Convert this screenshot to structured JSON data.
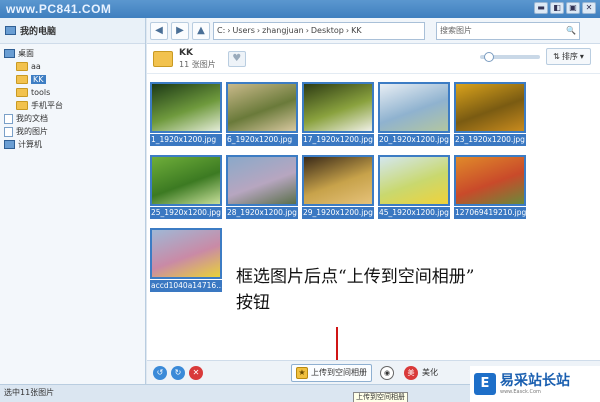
{
  "window": {
    "watermark": "www.PC841.COM",
    "buttons": [
      "▬",
      "◧",
      "▣",
      "✕"
    ]
  },
  "sidebar": {
    "title": "我的电脑",
    "items": [
      {
        "label": "桌面",
        "icon": "pc-icon"
      },
      {
        "label": "aa",
        "icon": "folder-icon"
      },
      {
        "label": "KK",
        "icon": "folder-icon",
        "selected": true
      },
      {
        "label": "tools",
        "icon": "folder-icon"
      },
      {
        "label": "手机平台",
        "icon": "folder-icon"
      },
      {
        "label": "我的文档",
        "icon": "doc-icon"
      },
      {
        "label": "我的图片",
        "icon": "doc-icon"
      },
      {
        "label": "计算机",
        "icon": "pc-icon"
      }
    ]
  },
  "toolbar": {
    "path": [
      "C:",
      "Users",
      "zhangjuan",
      "Desktop",
      "KK"
    ],
    "search_placeholder": "搜索图片"
  },
  "folder": {
    "name": "KK",
    "count": "11 张图片",
    "sort_label": "排序"
  },
  "thumbnails": [
    {
      "name": "1_1920x1200.jpg",
      "colors": [
        "#1d3a16",
        "#6f9a3d",
        "#e4ecd8"
      ]
    },
    {
      "name": "6_1920x1200.jpg",
      "colors": [
        "#c9b98a",
        "#6a7a3a",
        "#d8c8a0"
      ]
    },
    {
      "name": "17_1920x1200.jpg",
      "colors": [
        "#2e3c14",
        "#8aa23e",
        "#f1f1e8"
      ]
    },
    {
      "name": "20_1920x1200.jpg",
      "colors": [
        "#e8eef4",
        "#8fb2cf",
        "#b3c6a0"
      ]
    },
    {
      "name": "23_1920x1200.jpg",
      "colors": [
        "#d9a21c",
        "#7a5b12",
        "#c98b1e"
      ]
    },
    {
      "name": "25_1920x1200.jpg",
      "colors": [
        "#6fae3a",
        "#3c7a22",
        "#c7df9a"
      ]
    },
    {
      "name": "28_1920x1200.jpg",
      "colors": [
        "#8aa9c9",
        "#b7a6c0",
        "#5a6f4a"
      ]
    },
    {
      "name": "29_1920x1200.jpg",
      "colors": [
        "#3a2a18",
        "#c7a24a",
        "#e6c27a"
      ]
    },
    {
      "name": "45_1920x1200.jpg",
      "colors": [
        "#d4e7ef",
        "#c9d86e",
        "#f0d23a"
      ]
    },
    {
      "name": "127069419210.jpg",
      "colors": [
        "#e08a2a",
        "#c94a2a",
        "#6a8a3a"
      ]
    },
    {
      "name": "accd1040a14716…",
      "colors": [
        "#9fb8d6",
        "#c98aa6",
        "#e8d23a"
      ]
    }
  ],
  "annotation": {
    "line1": "框选图片后点“上传到空间相册”",
    "line2": "按钮"
  },
  "bottombar": {
    "upload_label": "上传到空间相册",
    "beauty_label": "美化",
    "tooltip": "上传到空间相册"
  },
  "status": {
    "text": "选中11张图片"
  },
  "brand": {
    "name": "易采站长站",
    "url": "www.Easck.Com"
  }
}
